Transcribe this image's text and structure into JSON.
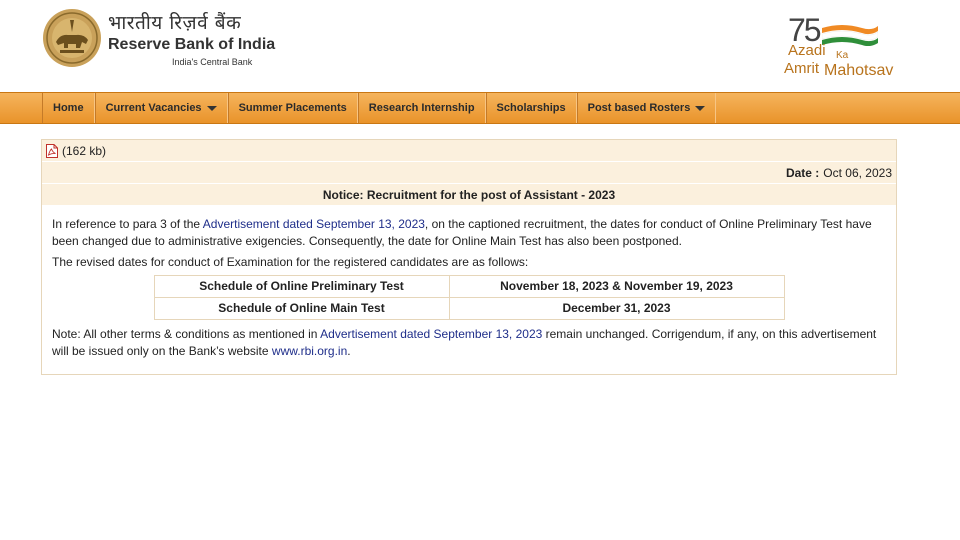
{
  "header": {
    "hindi_name": "भारतीय रिज़र्व बैंक",
    "english_name": "Reserve Bank of India",
    "tagline": "India's Central Bank",
    "azadi_logo": {
      "number": "75",
      "line1": "Azadi",
      "ka": "Ka",
      "line2": "Amrit",
      "line3": "Mahotsav"
    }
  },
  "nav": {
    "items": [
      {
        "label": "Home"
      },
      {
        "label": "Current Vacancies",
        "dropdown": true
      },
      {
        "label": "Summer Placements"
      },
      {
        "label": "Research Internship"
      },
      {
        "label": "Scholarships"
      },
      {
        "label": "Post based Rosters",
        "dropdown": true
      }
    ]
  },
  "notice": {
    "pdf_size": "(162 kb)",
    "date_label": "Date :",
    "date_value": "Oct 06, 2023",
    "title": "Notice: Recruitment for the post of Assistant - 2023",
    "para1_pre": "In reference to para 3 of the ",
    "para1_link": "Advertisement dated September 13, 2023",
    "para1_post": ", on the captioned recruitment, the dates for conduct of Online Preliminary Test have been changed due to administrative exigencies. Consequently, the date for Online Main Test has also been postponed.",
    "para2": "The revised dates for conduct of Examination for the registered candidates are as follows:",
    "schedule": [
      {
        "label": "Schedule of Online Preliminary Test",
        "value": "November 18, 2023 & November 19, 2023"
      },
      {
        "label": "Schedule of Online Main Test",
        "value": "December 31, 2023"
      }
    ],
    "note_pre": "Note: All other terms & conditions as mentioned in ",
    "note_link": "Advertisement dated September 13, 2023",
    "note_mid": " remain unchanged. Corrigendum, if any, on this advertisement will be issued only on the Bank’s website ",
    "note_site": "www.rbi.org.in",
    "note_end": "."
  },
  "colors": {
    "nav_bg": "#e9932a",
    "row_bg": "#fbf0dd",
    "link": "#1f2e8a",
    "logo_gold": "#b8731c"
  }
}
